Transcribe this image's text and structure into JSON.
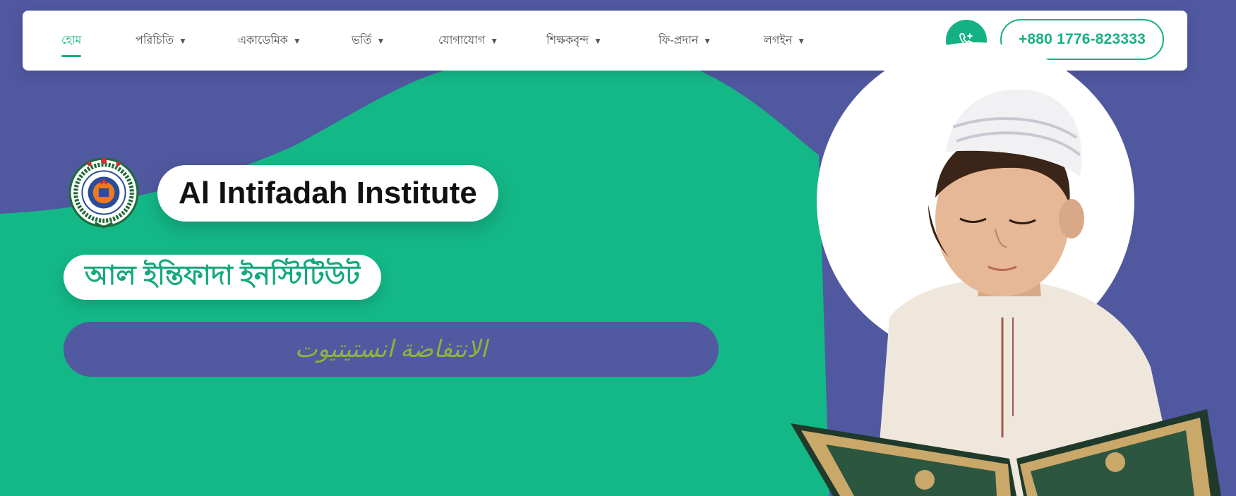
{
  "nav": {
    "items": [
      {
        "label": "হোম",
        "active": true,
        "dropdown": false
      },
      {
        "label": "পরিচিতি",
        "active": false,
        "dropdown": true
      },
      {
        "label": "একাডেমিক",
        "active": false,
        "dropdown": true
      },
      {
        "label": "ভর্তি",
        "active": false,
        "dropdown": true
      },
      {
        "label": "যোগাযোগ",
        "active": false,
        "dropdown": true
      },
      {
        "label": "শিক্ষকবৃন্দ",
        "active": false,
        "dropdown": true
      },
      {
        "label": "ফি-প্রদান",
        "active": false,
        "dropdown": true
      },
      {
        "label": "লগইন",
        "active": false,
        "dropdown": true
      }
    ],
    "call_icon": "phone-plus-icon",
    "phone_number": "+880 1776-823333"
  },
  "hero": {
    "logo_icon": "institute-logo-icon",
    "title_en": "Al Intifadah Institute",
    "title_bn": "আল ইন্তিফাদা ইনস্টিটিউট",
    "title_ar": "الانتفاضة انستيتيوت",
    "image": "child-reading-quran-image"
  },
  "colors": {
    "accent": "#14b184",
    "purple": "#5058a0",
    "arabic_text": "#8fb33a",
    "white": "#ffffff"
  }
}
